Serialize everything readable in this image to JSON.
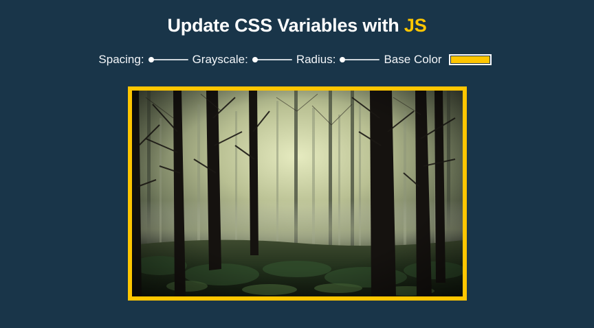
{
  "page": {
    "title_prefix": "Update CSS Variables with ",
    "title_highlight": "JS"
  },
  "controls": {
    "spacing": {
      "label": "Spacing:",
      "value_fraction": 0
    },
    "grayscale": {
      "label": "Grayscale:",
      "value_fraction": 0
    },
    "radius": {
      "label": "Radius:",
      "value_fraction": 0
    },
    "base_color": {
      "label": "Base Color",
      "value": "#ffc600"
    }
  },
  "image": {
    "subject": "misty forest photo"
  },
  "colors": {
    "background": "#193549",
    "accent": "#ffc600"
  }
}
